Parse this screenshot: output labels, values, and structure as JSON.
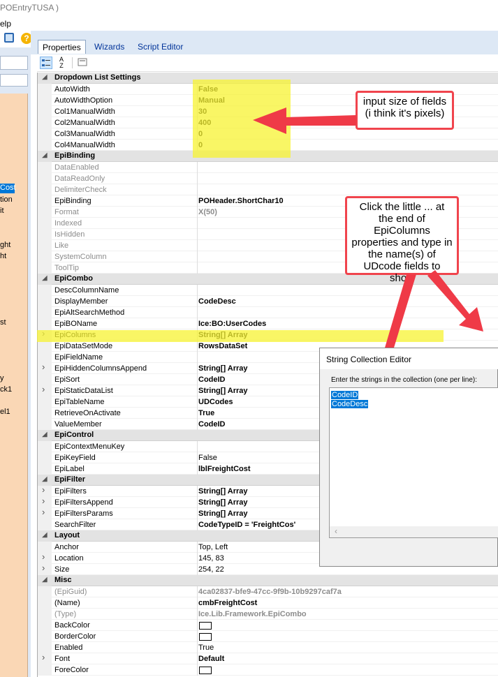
{
  "window": {
    "title": "POEntryTUSA )",
    "menu_fragment": "elp"
  },
  "left_panel": {
    "fragments": [
      "Cost",
      "tion",
      "it",
      "ght",
      "ht",
      "st",
      "y",
      "ck1",
      "el1"
    ],
    "selected_fragment": "Cost"
  },
  "tabs": [
    "Properties",
    "Wizards",
    "Script Editor"
  ],
  "active_tab": "Properties",
  "grid": {
    "rows": [
      {
        "type": "category",
        "name": "Dropdown List Settings"
      },
      {
        "name": "AutoWidth",
        "value": "False"
      },
      {
        "name": "AutoWidthOption",
        "value": "Manual"
      },
      {
        "name": "Col1ManualWidth",
        "value": "30"
      },
      {
        "name": "Col2ManualWidth",
        "value": "400"
      },
      {
        "name": "Col3ManualWidth",
        "value": "0"
      },
      {
        "name": "Col4ManualWidth",
        "value": "0"
      },
      {
        "type": "category",
        "name": "EpiBinding"
      },
      {
        "name": "DataEnabled",
        "value": "",
        "gray": true
      },
      {
        "name": "DataReadOnly",
        "value": "",
        "gray": true
      },
      {
        "name": "DelimiterCheck",
        "value": "",
        "gray": true
      },
      {
        "name": "EpiBinding",
        "value": "POHeader.ShortChar10"
      },
      {
        "name": "Format",
        "value": "X(50)",
        "gray": true
      },
      {
        "name": "Indexed",
        "value": "",
        "gray": true
      },
      {
        "name": "IsHidden",
        "value": "",
        "gray": true
      },
      {
        "name": "Like",
        "value": "",
        "gray": true
      },
      {
        "name": "SystemColumn",
        "value": "",
        "gray": true
      },
      {
        "name": "ToolTip",
        "value": "",
        "gray": true
      },
      {
        "type": "category",
        "name": "EpiCombo"
      },
      {
        "name": "DescColumnName",
        "value": ""
      },
      {
        "name": "DisplayMember",
        "value": "CodeDesc"
      },
      {
        "name": "EpiAltSearchMethod",
        "value": ""
      },
      {
        "name": "EpiBOName",
        "value": "Ice:BO:UserCodes"
      },
      {
        "name": "EpiColumns",
        "value": "String[] Array",
        "expand": true
      },
      {
        "name": "EpiDataSetMode",
        "value": "RowsDataSet"
      },
      {
        "name": "EpiFieldName",
        "value": ""
      },
      {
        "name": "EpiHiddenColumnsAppend",
        "value": "String[] Array",
        "expand": true
      },
      {
        "name": "EpiSort",
        "value": "CodeID"
      },
      {
        "name": "EpiStaticDataList",
        "value": "String[] Array",
        "expand": true
      },
      {
        "name": "EpiTableName",
        "value": "UDCodes"
      },
      {
        "name": "RetrieveOnActivate",
        "value": "True"
      },
      {
        "name": "ValueMember",
        "value": "CodeID"
      },
      {
        "type": "category",
        "name": "EpiControl"
      },
      {
        "name": "EpiContextMenuKey",
        "value": ""
      },
      {
        "name": "EpiKeyField",
        "value": "False",
        "normal": true
      },
      {
        "name": "EpiLabel",
        "value": "lblFreightCost"
      },
      {
        "type": "category",
        "name": "EpiFilter"
      },
      {
        "name": "EpiFilters",
        "value": "String[] Array",
        "expand": true
      },
      {
        "name": "EpiFiltersAppend",
        "value": "String[] Array",
        "expand": true
      },
      {
        "name": "EpiFiltersParams",
        "value": "String[] Array",
        "expand": true
      },
      {
        "name": "SearchFilter",
        "value": "CodeTypeID = 'FreightCos'"
      },
      {
        "type": "category",
        "name": "Layout"
      },
      {
        "name": "Anchor",
        "value": "Top, Left",
        "normal": true
      },
      {
        "name": "Location",
        "value": "145, 83",
        "normal": true,
        "expand": true
      },
      {
        "name": "Size",
        "value": "254, 22",
        "normal": true,
        "expand": true
      },
      {
        "type": "category",
        "name": "Misc"
      },
      {
        "name": "(EpiGuid)",
        "value": "4ca02837-bfe9-47cc-9f9b-10b9297caf7a",
        "gray": true
      },
      {
        "name": "(Name)",
        "value": "cmbFreightCost"
      },
      {
        "name": "(Type)",
        "value": "Ice.Lib.Framework.EpiCombo",
        "gray": true
      },
      {
        "name": "BackColor",
        "value": "",
        "swatch": true
      },
      {
        "name": "BorderColor",
        "value": "",
        "swatch": true
      },
      {
        "name": "Enabled",
        "value": "True",
        "normal": true
      },
      {
        "name": "Font",
        "value": "Default",
        "expand": true
      },
      {
        "name": "ForeColor",
        "value": "",
        "swatch": true
      }
    ]
  },
  "callouts": {
    "widths": "input size of fields (i think it's pixels)",
    "epicolumns": "Click the little ... at the end of EpiColumns properties and type in the name(s) of UDcode fields to show"
  },
  "dialog": {
    "title": "String Collection Editor",
    "label": "Enter the strings in the collection (one per line):",
    "lines": [
      "CodeID",
      "CodeDesc"
    ]
  },
  "colors": {
    "highlight": "#f7f332",
    "callout_border": "#f0444d",
    "arrow": "#ef3a47",
    "selection": "#0078d7"
  },
  "icons": [
    "categorized-icon",
    "alphabetical-sort-icon",
    "property-pages-icon",
    "search-icon",
    "help-icon"
  ]
}
